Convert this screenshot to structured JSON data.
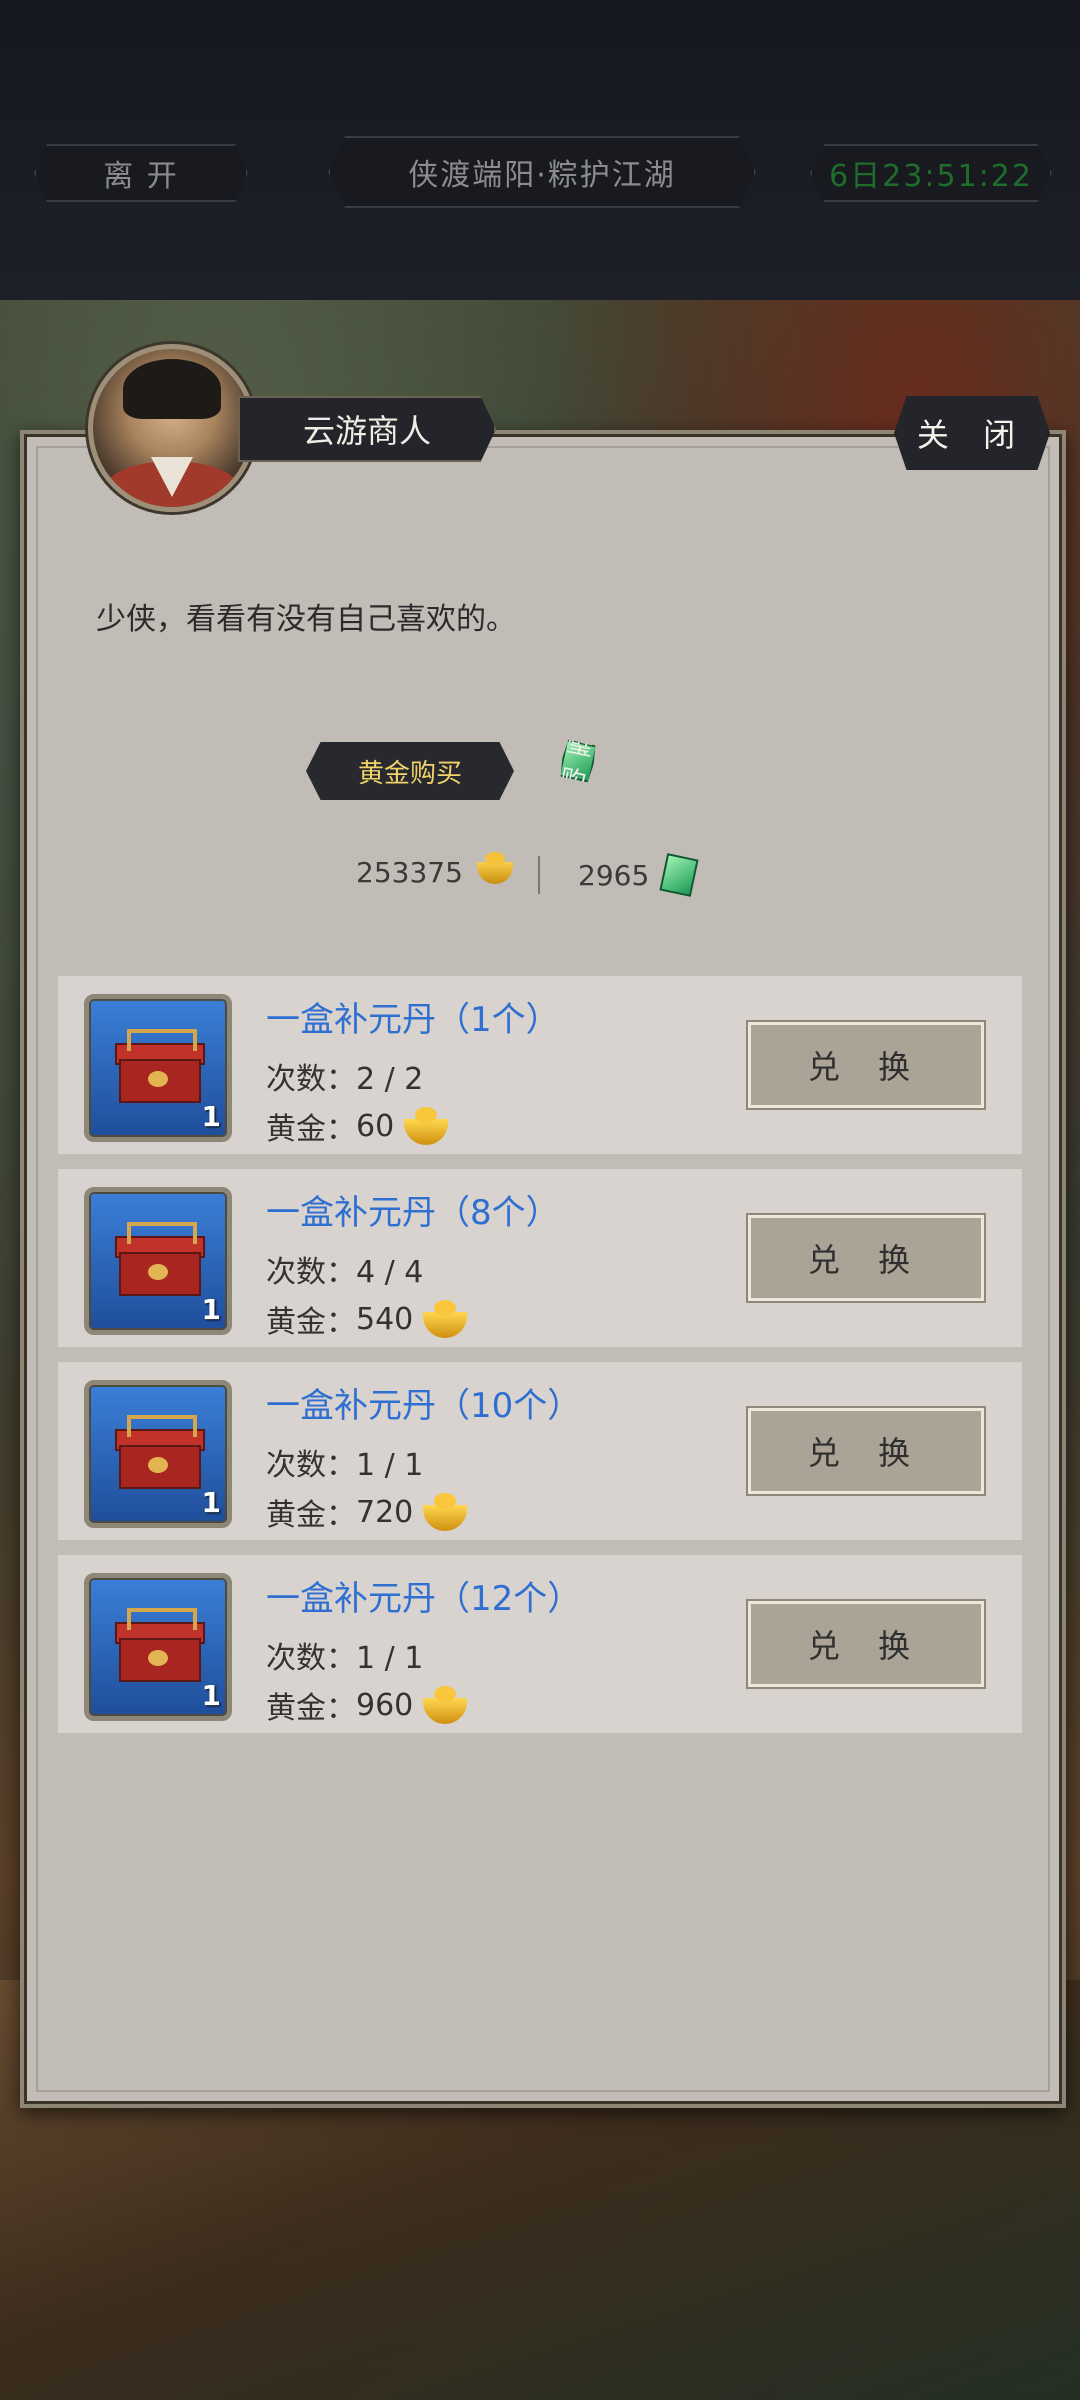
{
  "header": {
    "leave_label": "离 开",
    "event_title": "侠渡端阳·粽护江湖",
    "timer": "6日23:51:22"
  },
  "npc": {
    "name": "云游商人",
    "close_label": "关 闭",
    "greeting": "少侠，看看有没有自己喜欢的。"
  },
  "tabs": {
    "gold": "黄金购买",
    "jade": "玉璧购买"
  },
  "balances": {
    "gold": "253375",
    "jade": "2965"
  },
  "items": [
    {
      "name": "一盒补元丹（1个）",
      "count": "次数：2 / 2",
      "price_label": "黄金：",
      "price": "60",
      "qty": "1",
      "button": "兑 换"
    },
    {
      "name": "一盒补元丹（8个）",
      "count": "次数：4 / 4",
      "price_label": "黄金：",
      "price": "540",
      "qty": "1",
      "button": "兑 换"
    },
    {
      "name": "一盒补元丹（10个）",
      "count": "次数：1 / 1",
      "price_label": "黄金：",
      "price": "720",
      "qty": "1",
      "button": "兑 换"
    },
    {
      "name": "一盒补元丹（12个）",
      "count": "次数：1 / 1",
      "price_label": "黄金：",
      "price": "960",
      "qty": "1",
      "button": "兑 换"
    }
  ],
  "icons": {
    "currency_gold": "gold-ingot-icon",
    "currency_jade": "jade-icon",
    "item": "red-chest-icon"
  }
}
